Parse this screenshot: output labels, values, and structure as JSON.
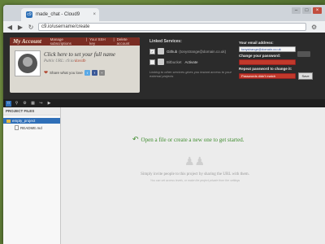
{
  "browser": {
    "tab_title": "made_chat - Cloud9",
    "favicon_label": "c9",
    "tab_close": "×",
    "url": "c9.io/username/create",
    "window_buttons": [
      "–",
      "□",
      "×"
    ]
  },
  "account": {
    "title": "My Account",
    "links": [
      "Manage subscriptions",
      "Your SSH key",
      "Delete account"
    ],
    "name_placeholder": "Click here to set your full name",
    "public_url_prefix": "Public URL: c9.io/",
    "public_url_user": "davidb",
    "share_label": "Share what you love"
  },
  "linked_services": {
    "title": "Linked Services:",
    "services": [
      {
        "name": "Github",
        "detail": "(tonystrange@domain.co.uk)",
        "checked": true
      },
      {
        "name": "Bitbucket",
        "detail": "",
        "action": "Activate",
        "checked": false
      }
    ],
    "note": "Linking to other services gives you instant access to your external projects"
  },
  "email": {
    "label": "Your email address:",
    "value": "tonystrange@domain.co.uk",
    "change_password_label": "Change your password:",
    "repeat_label": "Repeat password to change it:",
    "error_text": "Passwords didn't match",
    "save_label": "Save"
  },
  "sidebar": {
    "title": "PROJECT FILES",
    "project": "empty_project",
    "files": [
      "README.md"
    ]
  },
  "main": {
    "open_hint": "Open a file or create a new one to get started.",
    "invite_text": "Simply invite people to this project by sharing the URL with them.",
    "invite_sub": "You can set access levels, or make the project private from the settings"
  },
  "colors": {
    "accent": "#2f6fb8",
    "hint_green": "#3d8b2c",
    "error_red": "#c0392b",
    "card_header": "#7a2d23"
  }
}
